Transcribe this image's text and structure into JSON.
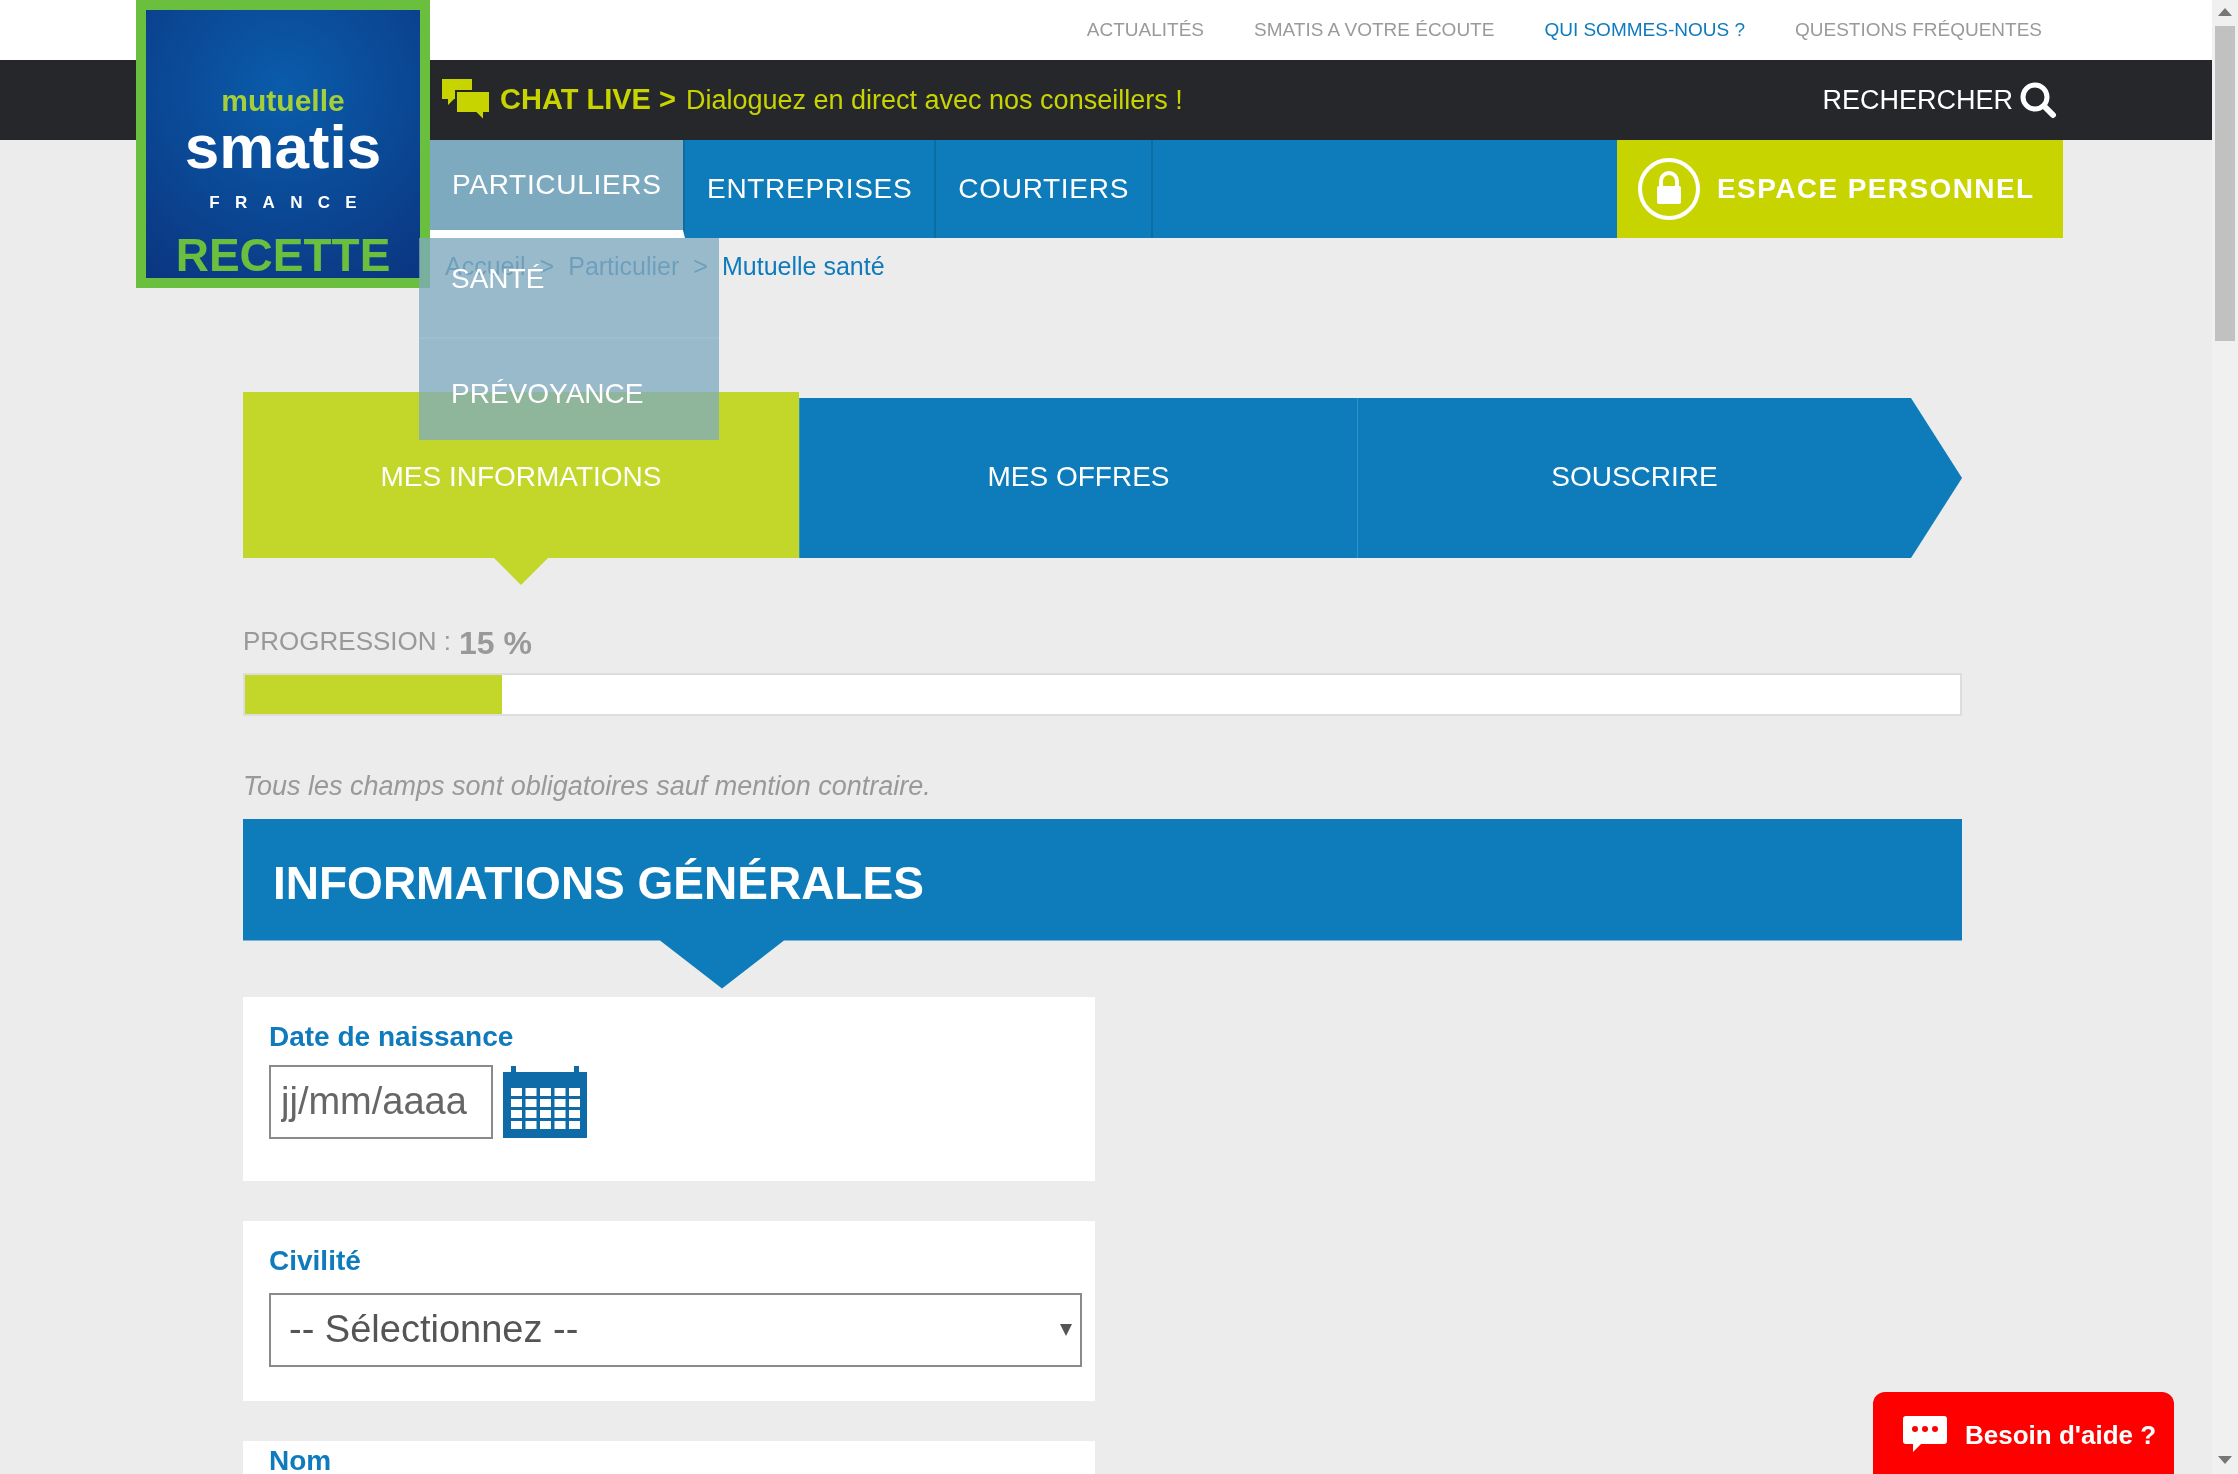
{
  "logo": {
    "line_1": "mutuelle",
    "line_2": "smatis",
    "line_3": "FRANCE",
    "line_4": "RECETTE"
  },
  "top_links": [
    {
      "label": "ACTUALITÉS",
      "selected": false
    },
    {
      "label": "SMATIS A VOTRE ÉCOUTE",
      "selected": false
    },
    {
      "label": "QUI SOMMES-NOUS ?",
      "selected": true
    },
    {
      "label": "QUESTIONS FRÉQUENTES",
      "selected": false
    }
  ],
  "chat_live": {
    "label": "CHAT LIVE >",
    "message": "Dialoguez en direct avec nos conseillers !"
  },
  "search": {
    "label": "RECHERCHER"
  },
  "nav_tabs": [
    {
      "label": "PARTICULIERS",
      "selected": true
    },
    {
      "label": "ENTREPRISES",
      "selected": false
    },
    {
      "label": "COURTIERS",
      "selected": false
    }
  ],
  "account_button": {
    "label": "ESPACE PERSONNEL"
  },
  "breadcrumb": [
    {
      "kind": "link",
      "text": "Accueil"
    },
    {
      "kind": "separator",
      "text": ">"
    },
    {
      "kind": "link",
      "text": "Particulier"
    },
    {
      "kind": "separator",
      "text": ">"
    },
    {
      "kind": "current",
      "text": "Mutuelle santé"
    }
  ],
  "dropdown": {
    "items": [
      {
        "label": "SANTÉ"
      },
      {
        "label": "PRÉVOYANCE"
      }
    ]
  },
  "steps": [
    {
      "label": "MES INFORMATIONS",
      "selected": true
    },
    {
      "label": "MES OFFRES",
      "selected": false
    },
    {
      "label": "SOUSCRIRE",
      "selected": false
    }
  ],
  "progress": {
    "label": "PROGRESSION :",
    "value": "15 %",
    "level": 0.15
  },
  "note": "Tous les champs sont obligatoires sauf mention contraire.",
  "section": {
    "title": "INFORMATIONS GÉNÉRALES"
  },
  "fields": [
    {
      "kind": "date",
      "label": "Date de naissance",
      "placeholder": "jj/mm/aaaa"
    },
    {
      "kind": "select",
      "label": "Civilité",
      "value": "-- Sélectionnez --"
    },
    {
      "kind": "text",
      "label": "Nom"
    }
  ],
  "help_button": {
    "label": "Besoin d'aide ?"
  }
}
